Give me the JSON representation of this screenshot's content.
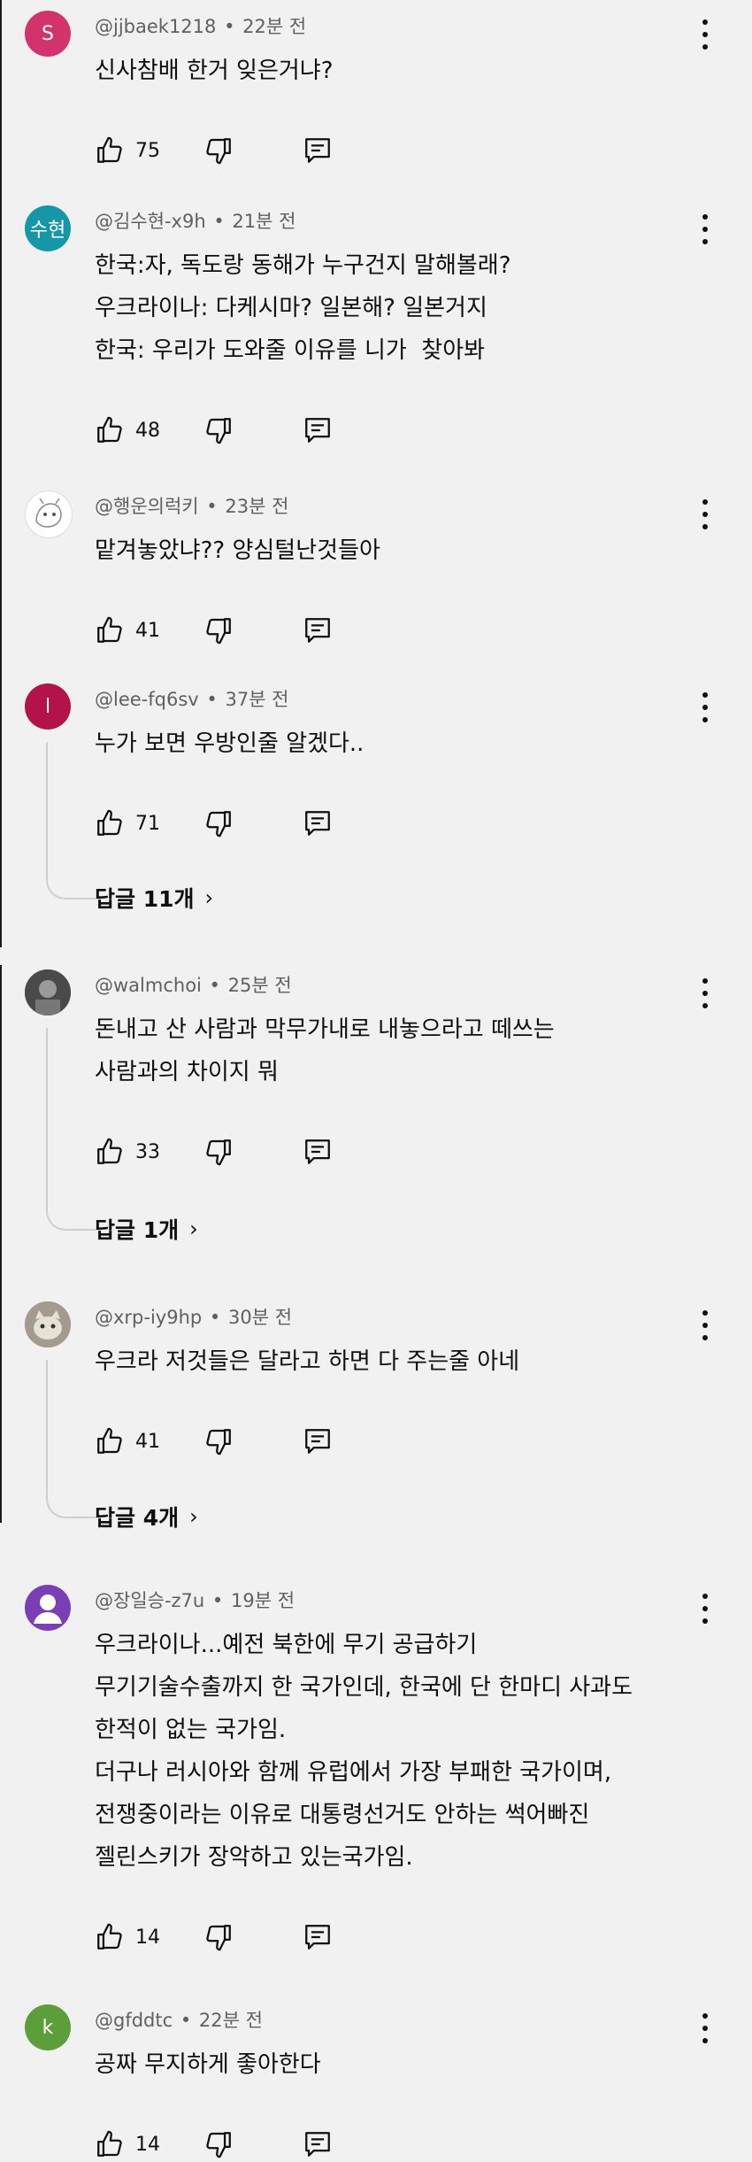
{
  "comments": [
    {
      "author": "@jjbaek1218",
      "time": "22분 전",
      "avatar_letter": "S",
      "avatar_color": "#d3336c",
      "lines": [
        "신사참배 한거 잊은거냐?"
      ],
      "likes": "75"
    },
    {
      "author": "@김수현-x9h",
      "time": "21분 전",
      "avatar_letter": "수현",
      "avatar_color": "#1597a8",
      "lines": [
        "한국:자, 독도랑 동해가 누구건지 말해볼래?",
        "우크라이나: 다케시마? 일본해? 일본거지",
        "한국: 우리가 도와줄 이유를 니가  찾아봐"
      ],
      "likes": "48"
    },
    {
      "author": "@행운의럭키",
      "time": "23분 전",
      "avatar_letter": "",
      "avatar_color": "#ffffff",
      "lines": [
        "맡겨놓았냐?? 양심털난것들아"
      ],
      "likes": "41"
    },
    {
      "author": "@lee-fq6sv",
      "time": "37분 전",
      "avatar_letter": "l",
      "avatar_color": "#b3124a",
      "lines": [
        "누가 보면 우방인줄 알겠다.."
      ],
      "likes": "71",
      "replies": "답글 11개"
    },
    {
      "author": "@walmchoi",
      "time": "25분 전",
      "avatar_letter": "",
      "avatar_color": "#3d3d3d",
      "lines": [
        "돈내고 산 사람과 막무가내로 내놓으라고 떼쓰는",
        "사람과의 차이지 뭐"
      ],
      "likes": "33",
      "replies": "답글 1개"
    },
    {
      "author": "@xrp-iy9hp",
      "time": "30분 전",
      "avatar_letter": "",
      "avatar_color": "#8b7b6b",
      "lines": [
        "우크라 저것들은 달라고 하면 다 주는줄 아네"
      ],
      "likes": "41",
      "replies": "답글 4개"
    },
    {
      "author": "@장일승-z7u",
      "time": "19분 전",
      "avatar_letter": "",
      "avatar_color": "#7b3fb5",
      "lines": [
        "우크라이나...예전 북한에 무기 공급하기",
        "무기기술수출까지 한 국가인데, 한국에 단 한마디 사과도",
        "한적이 없는 국가임.",
        "더구나 러시아와 함께 유럽에서 가장 부패한 국가이며,",
        "전쟁중이라는 이유로 대통령선거도 안하는 썩어빠진",
        "젤린스키가 장악하고 있는국가임."
      ],
      "likes": "14"
    },
    {
      "author": "@gfddtc",
      "time": "22분 전",
      "avatar_letter": "k",
      "avatar_color": "#5b9e3a",
      "lines": [
        "공짜 무지하게 좋아한다"
      ],
      "likes": "14"
    }
  ]
}
